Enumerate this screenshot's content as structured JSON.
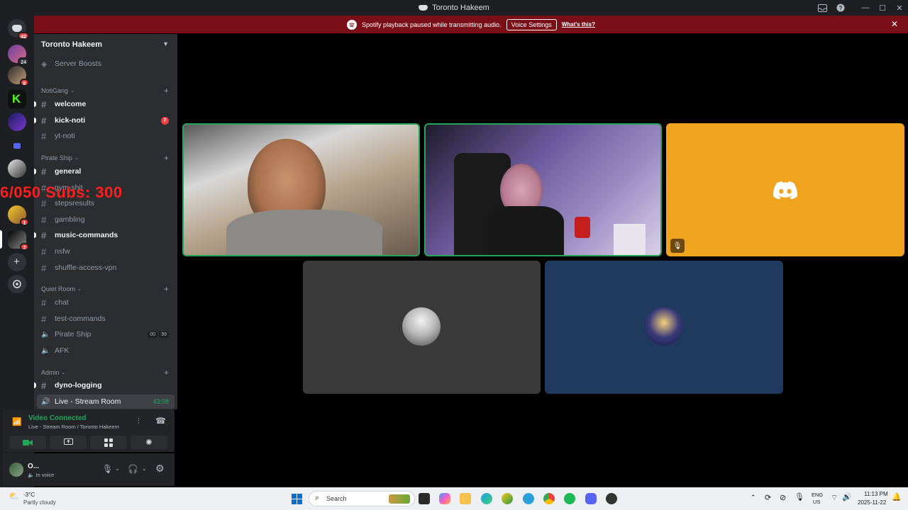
{
  "titlebar": {
    "title": "Toronto Hakeem"
  },
  "banner": {
    "message": "Spotify playback paused while transmitting audio.",
    "voice_settings": "Voice Settings",
    "whats_this": "What's this?"
  },
  "server": {
    "name": "Toronto Hakeem",
    "boosts": "Server Boosts"
  },
  "guilds": {
    "home_badge": "42",
    "badges": [
      "24",
      "8",
      "1",
      "7"
    ]
  },
  "categories": {
    "notigang": "NotiGang",
    "pirate_ship": "Pirate Ship",
    "quiet_room": "Quiet Room",
    "admin": "Admin"
  },
  "channels": {
    "welcome": "welcome",
    "kick_noti": "kick-noti",
    "kick_noti_badge": "7",
    "yt_noti": "yt-noti",
    "general": "general",
    "gym": "gym-shit",
    "stepsresults": "stepsresults",
    "gambling": "gambling",
    "music_commands": "music-commands",
    "nsfw": "nsfw",
    "shuffle": "shuffle-access-vpn",
    "chat": "chat",
    "test_commands": "test-commands",
    "pirate_voice": "Pirate Ship",
    "pirate_voice_counts": [
      "00",
      "99"
    ],
    "afk": "AFK",
    "dyno": "dyno-logging",
    "live": "Live - Stream Room",
    "live_time": "43:08"
  },
  "overlay": {
    "text": "6/050  Subs: 300"
  },
  "voice": {
    "status": "Video Connected",
    "location": "Live - Stream Room / Toronto Hakeem"
  },
  "user": {
    "name": "O...",
    "status": "In voice"
  },
  "taskbar": {
    "temp": "-3°C",
    "weather": "Partly cloudy",
    "search": "Search",
    "lang1": "ENG",
    "lang2": "US",
    "time": "11:13 PM",
    "date": "2025-11-22"
  },
  "colors": {
    "banner": "#7a0f17",
    "discord_tile": "#f0a31e",
    "tile_gray": "#3a3a3a",
    "tile_blue": "#1f3a5c",
    "speaking": "#23a55a"
  }
}
